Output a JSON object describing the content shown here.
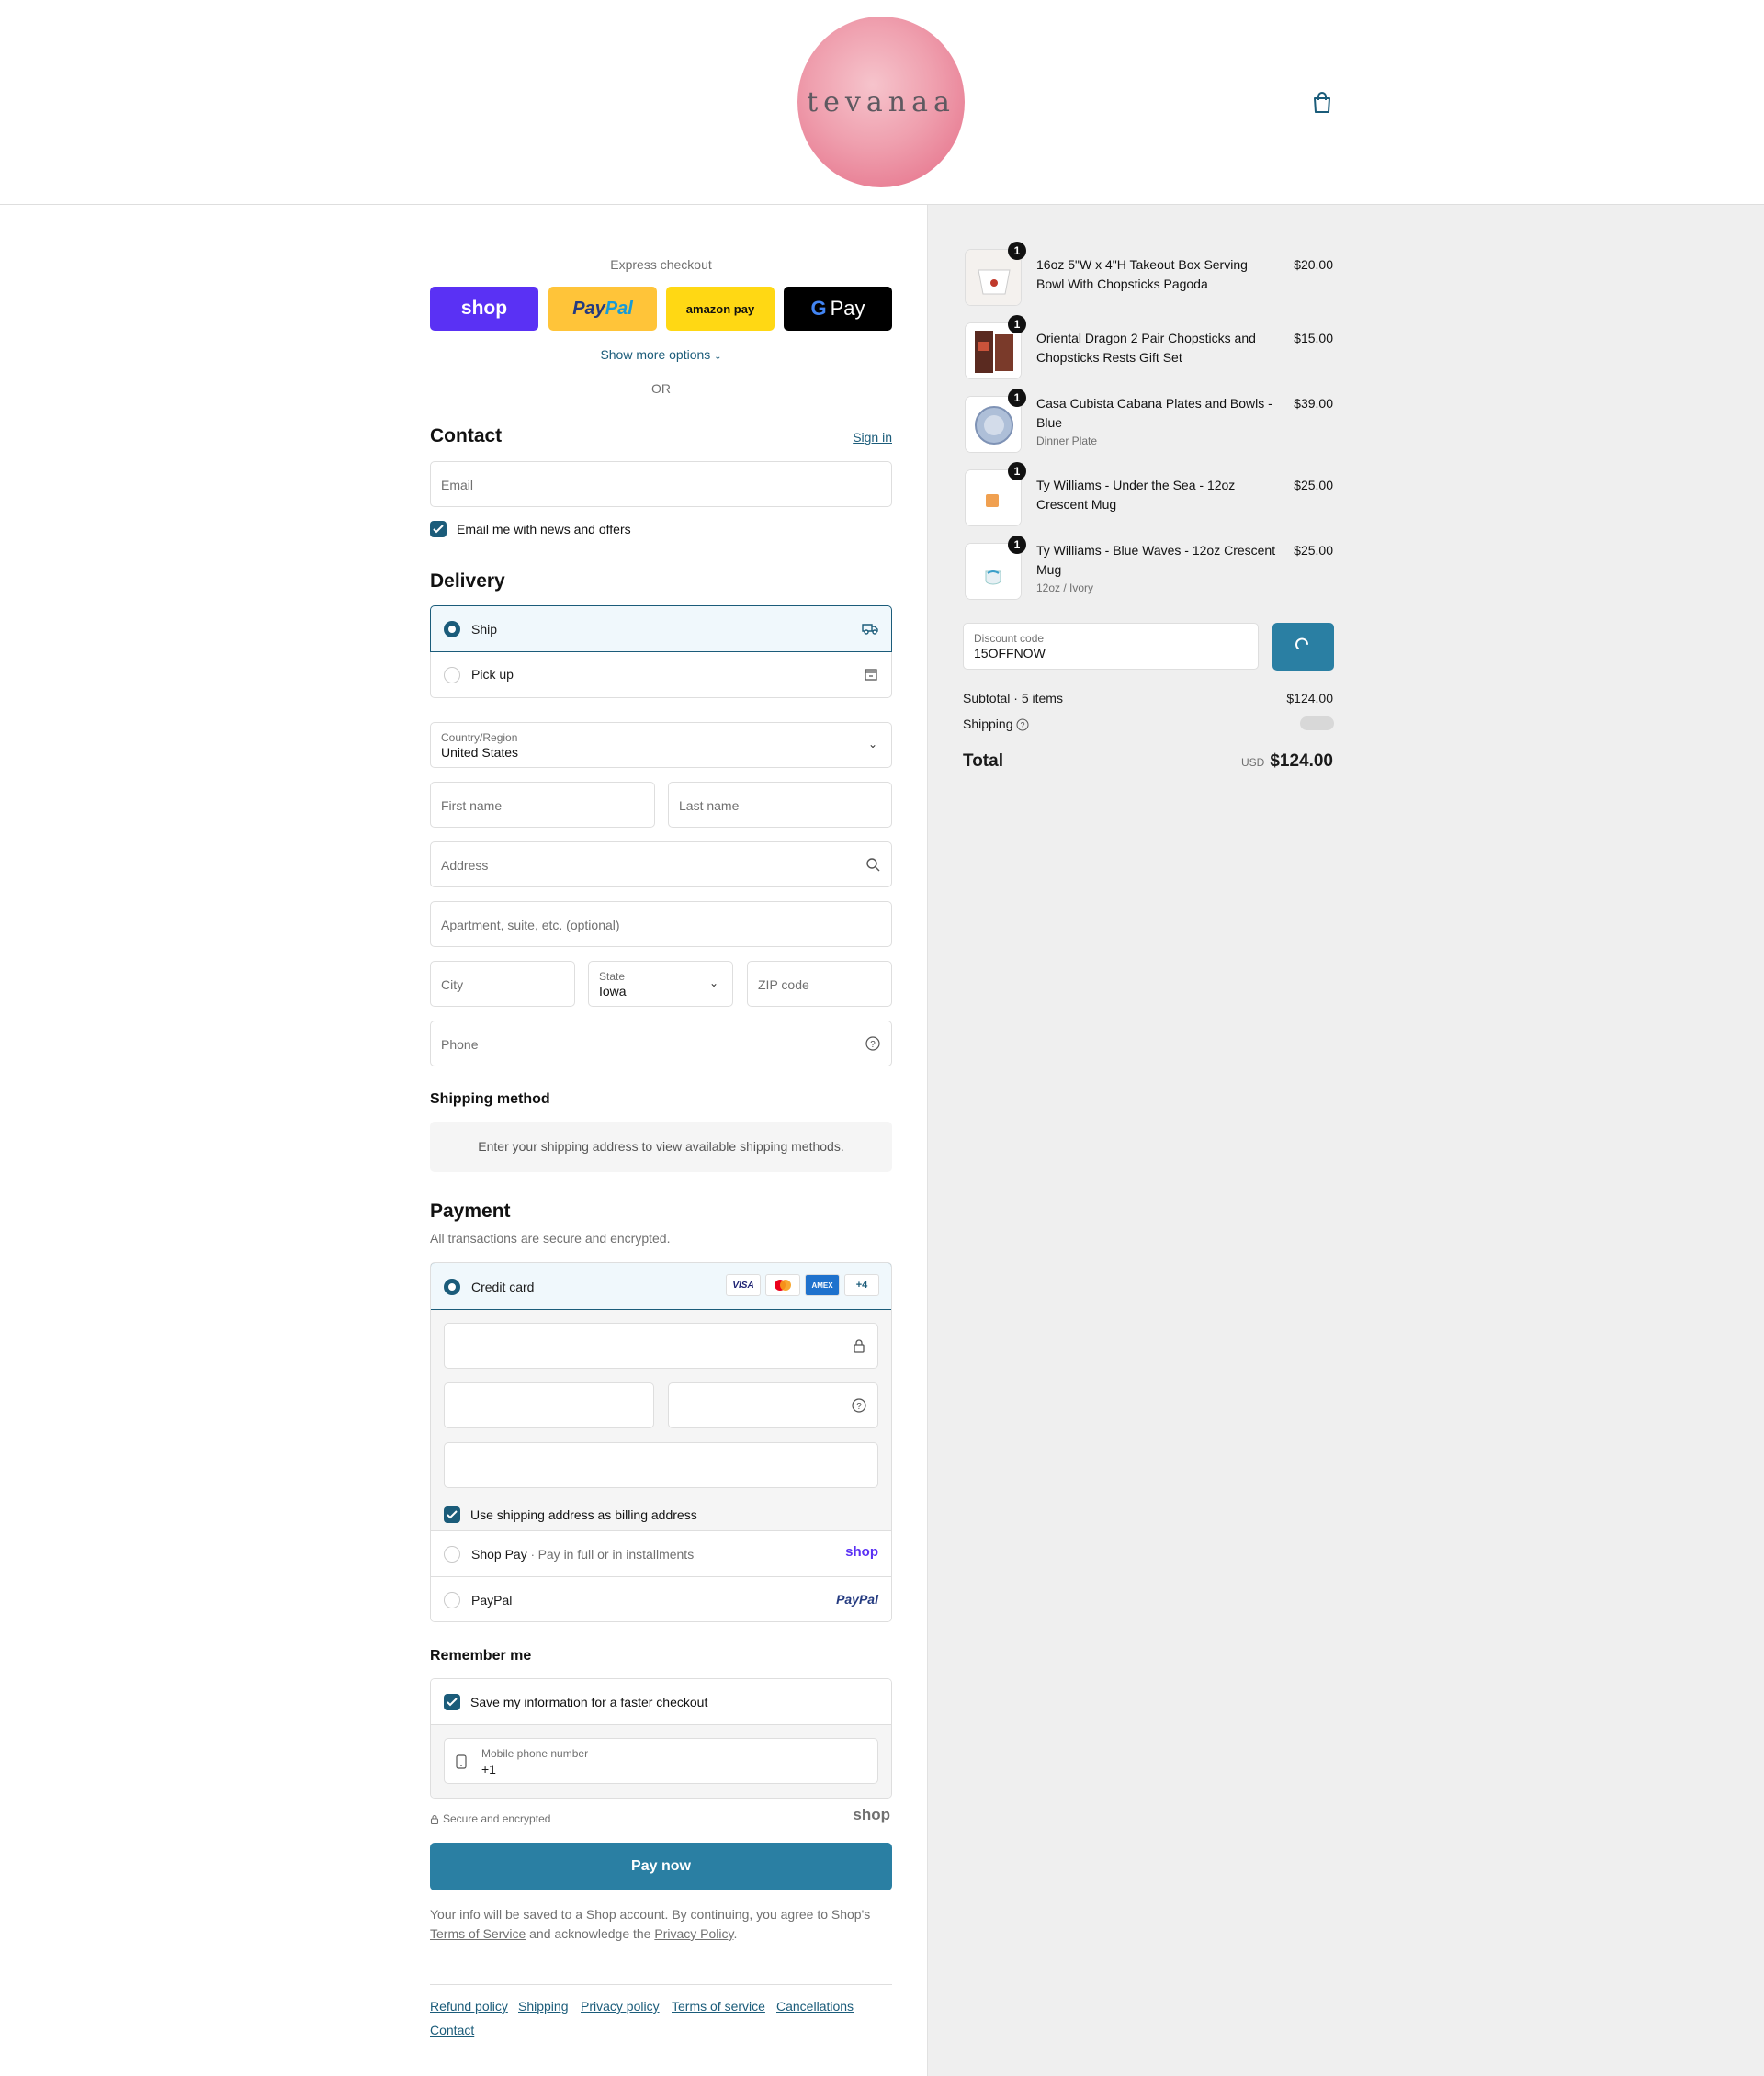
{
  "brand": {
    "name": "tevanaa"
  },
  "express": {
    "title": "Express checkout",
    "buttons": {
      "shop": "shop",
      "paypal_a": "Pay",
      "paypal_b": "Pal",
      "amazon": "amazon pay",
      "gpay_g": "G",
      "gpay": "Pay"
    },
    "show_more": "Show more options",
    "or": "OR"
  },
  "contact": {
    "title": "Contact",
    "sign_in": "Sign in",
    "email_placeholder": "Email",
    "news_label": "Email me with news and offers"
  },
  "delivery": {
    "title": "Delivery",
    "options": [
      {
        "label": "Ship",
        "selected": true
      },
      {
        "label": "Pick up",
        "selected": false
      }
    ],
    "country_label": "Country/Region",
    "country_value": "United States",
    "first_name": "First name",
    "last_name": "Last name",
    "address": "Address",
    "apartment": "Apartment, suite, etc. (optional)",
    "city": "City",
    "state_label": "State",
    "state_value": "Iowa",
    "zip": "ZIP code",
    "phone": "Phone"
  },
  "shipping_method": {
    "title": "Shipping method",
    "note": "Enter your shipping address to view available shipping methods."
  },
  "payment": {
    "title": "Payment",
    "subtitle": "All transactions are secure and encrypted.",
    "credit_card": "Credit card",
    "cards": [
      "VISA",
      "MC",
      "AMEX",
      "+4"
    ],
    "billing_label": "Use shipping address as billing address",
    "shop_pay": "Shop Pay",
    "shop_pay_desc": "Pay in full or in installments",
    "shop_logo": "shop",
    "paypal": "PayPal",
    "paypal_logo": "PayPal"
  },
  "remember": {
    "title": "Remember me",
    "save_label": "Save my information for a faster checkout",
    "mobile_label": "Mobile phone number",
    "mobile_value": "+1",
    "secure": "Secure and encrypted",
    "shop_logo": "shop"
  },
  "pay_now": "Pay now",
  "legal": {
    "text_1": "Your info will be saved to a Shop account. By continuing, you agree to Shop's",
    "terms": "Terms of Service",
    "text_2": "and acknowledge the",
    "privacy": "Privacy Policy",
    "text_3": "."
  },
  "footer_links": [
    "Refund policy",
    "Shipping",
    "Privacy policy",
    "Terms of service",
    "Cancellations",
    "Contact"
  ],
  "summary": {
    "items": [
      {
        "qty": "1",
        "name": "16oz 5\"W x 4\"H Takeout Box Serving Bowl With Chopsticks Pagoda",
        "variant": "",
        "price": "$20.00"
      },
      {
        "qty": "1",
        "name": "Oriental Dragon 2 Pair Chopsticks and Chopsticks Rests Gift Set",
        "variant": "",
        "price": "$15.00"
      },
      {
        "qty": "1",
        "name": "Casa Cubista Cabana Plates and Bowls - Blue",
        "variant": "Dinner Plate",
        "price": "$39.00"
      },
      {
        "qty": "1",
        "name": "Ty Williams - Under the Sea - 12oz Crescent Mug",
        "variant": "",
        "price": "$25.00"
      },
      {
        "qty": "1",
        "name": "Ty Williams - Blue Waves - 12oz Crescent Mug",
        "variant": "12oz / Ivory",
        "price": "$25.00"
      }
    ],
    "discount_label": "Discount code",
    "discount_value": "15OFFNOW",
    "subtotal_label": "Subtotal · 5 items",
    "subtotal_value": "$124.00",
    "shipping_label": "Shipping",
    "total_label": "Total",
    "currency": "USD",
    "total_value": "$124.00"
  },
  "colors": {
    "accent": "#1b5c7a",
    "button": "#2a7fa3",
    "summary_bg": "#efefef"
  }
}
